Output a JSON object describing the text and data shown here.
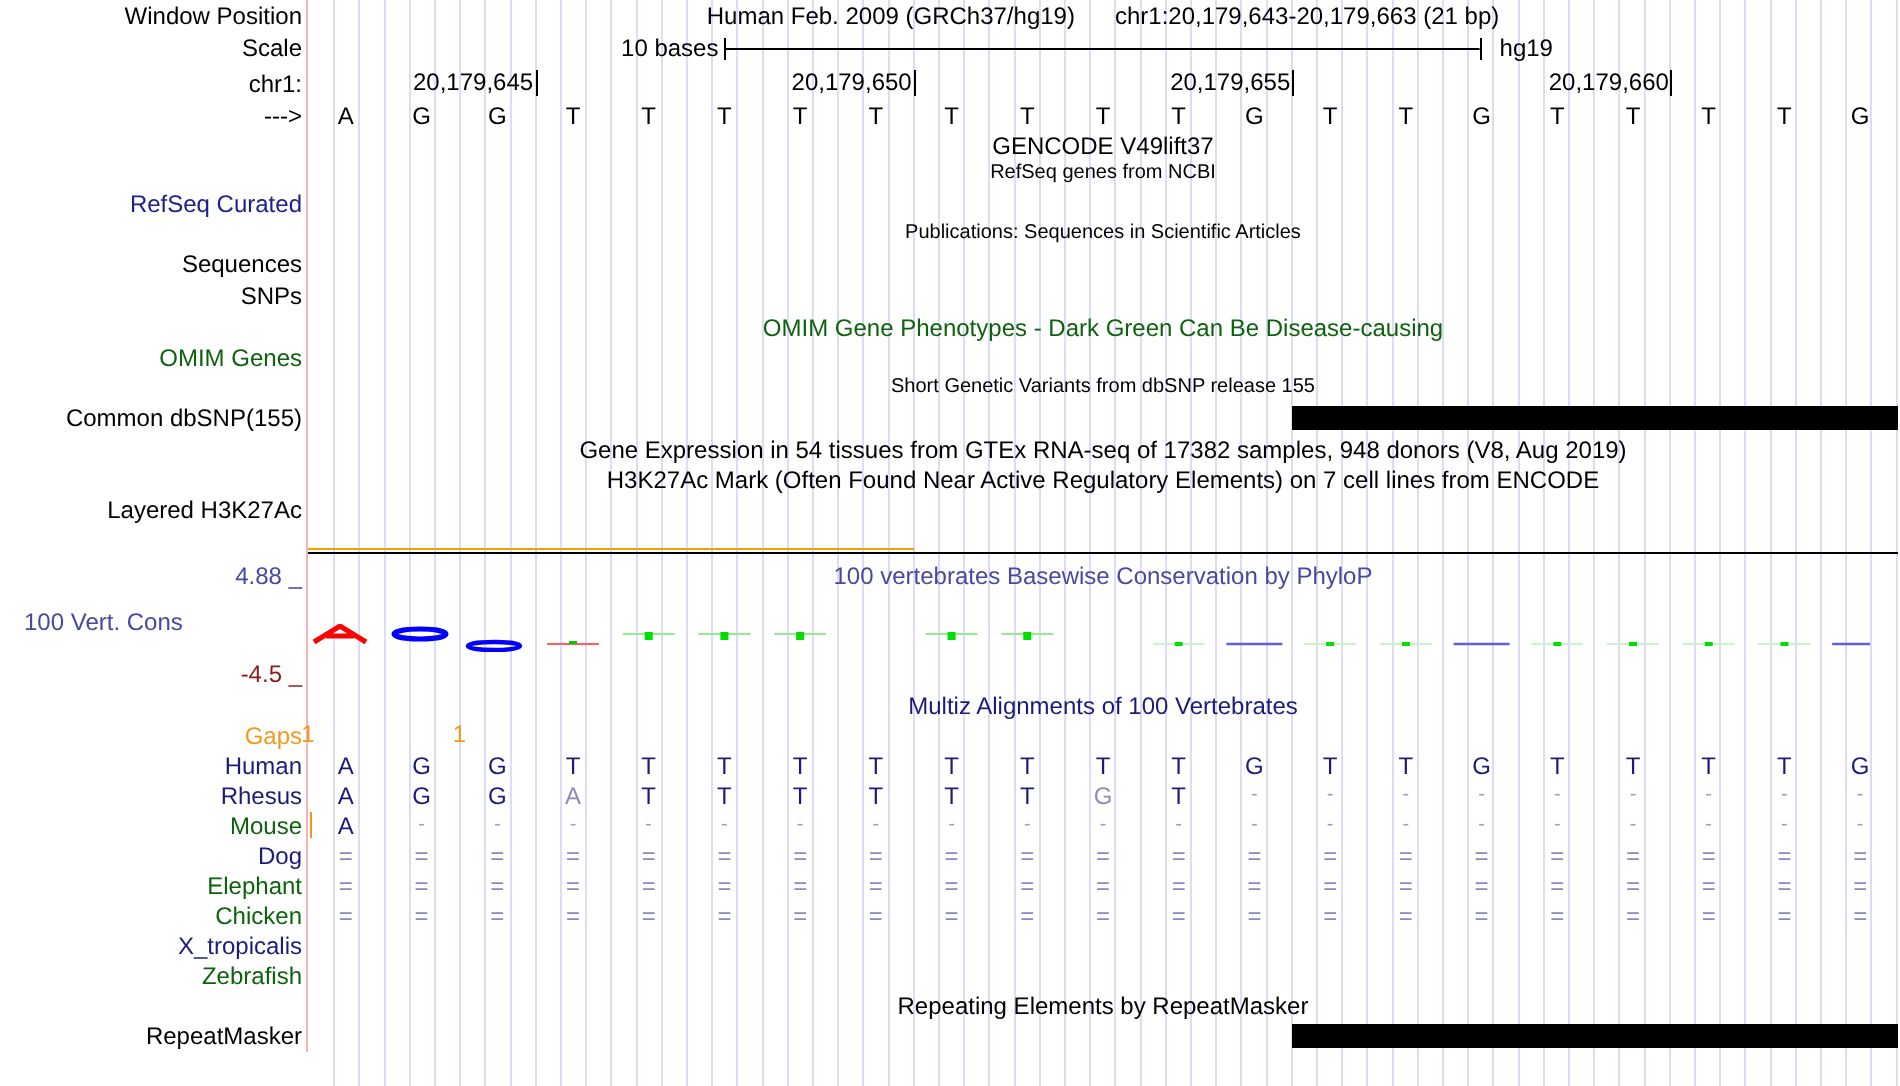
{
  "position": {
    "label": "Window Position",
    "assembly": "Human Feb. 2009 (GRCh37/hg19)",
    "range": "chr1:20,179,643-20,179,663 (21 bp)"
  },
  "scale": {
    "label": "Scale",
    "length": "10 bases",
    "assembly": "hg19"
  },
  "coordinates": {
    "label": "chr1:"
  },
  "sequence": {
    "label": "--->",
    "bases": [
      {
        "base": "A",
        "gap_before": "1"
      },
      {
        "base": "G"
      },
      {
        "base": "G",
        "tick": "20,179,645",
        "gap_before": "1"
      },
      {
        "base": "T"
      },
      {
        "base": "T"
      },
      {
        "base": "T"
      },
      {
        "base": "T"
      },
      {
        "base": "T",
        "tick": "20,179,650"
      },
      {
        "base": "T"
      },
      {
        "base": "T"
      },
      {
        "base": "T"
      },
      {
        "base": "T"
      },
      {
        "base": "G",
        "tick": "20,179,655"
      },
      {
        "base": "T"
      },
      {
        "base": "T"
      },
      {
        "base": "G"
      },
      {
        "base": "T"
      },
      {
        "base": "T",
        "tick": "20,179,660"
      },
      {
        "base": "T"
      },
      {
        "base": "T"
      },
      {
        "base": "G"
      }
    ]
  },
  "tracks": [
    {
      "kind": "title",
      "text": "GENCODE V49lift37",
      "color": "#000000"
    },
    {
      "kind": "subtitle",
      "text": "RefSeq genes from NCBI",
      "color": "#000000"
    },
    {
      "kind": "label",
      "label": "RefSeq Curated",
      "color": "#20208c"
    },
    {
      "kind": "subtitle",
      "text": "Publications: Sequences in Scientific Articles",
      "color": "#000000"
    },
    {
      "kind": "label",
      "label": "Sequences",
      "color": "#000000"
    },
    {
      "kind": "label",
      "label": "SNPs",
      "color": "#000000"
    },
    {
      "kind": "title",
      "text": "OMIM Gene Phenotypes - Dark Green Can Be Disease-causing",
      "color": "#0e620e"
    },
    {
      "kind": "label",
      "label": "OMIM Genes",
      "color": "#0e620e"
    },
    {
      "kind": "subtitle",
      "text": "Short Genetic Variants from dbSNP release 155",
      "color": "#000000"
    },
    {
      "kind": "label",
      "label": "Common dbSNP(155)",
      "color": "#000000",
      "feature": true
    },
    {
      "kind": "title",
      "text": "Gene Expression in 54 tissues from GTEx RNA-seq of 17382 samples, 948 donors (V8, Aug 2019)",
      "color": "#000000"
    },
    {
      "kind": "title",
      "text": "H3K27Ac Mark (Often Found Near Active Regulatory Elements) on 7 cell lines from ENCODE",
      "color": "#000000"
    },
    {
      "kind": "label",
      "label": "Layered H3K27Ac",
      "color": "#000000"
    },
    {
      "kind": "baseline",
      "highlight": true
    },
    {
      "kind": "conservation",
      "title": "100 vertebrates Basewise Conservation by PhyloP",
      "label": "100 Vert. Cons",
      "max": "4.88 _",
      "min": "-4.5 _"
    },
    {
      "kind": "alignment",
      "title": "Multiz Alignments of 100 Vertebrates",
      "gaps_label": "Gaps",
      "species": [
        {
          "name": "Human",
          "color": "#1c1c78",
          "insertion": false,
          "cells": [
            {
              "base": "A",
              "kind": "match"
            },
            {
              "base": "G",
              "kind": "match"
            },
            {
              "base": "G",
              "kind": "match"
            },
            {
              "base": "T",
              "kind": "match"
            },
            {
              "base": "T",
              "kind": "match"
            },
            {
              "base": "T",
              "kind": "match"
            },
            {
              "base": "T",
              "kind": "match"
            },
            {
              "base": "T",
              "kind": "match"
            },
            {
              "base": "T",
              "kind": "match"
            },
            {
              "base": "T",
              "kind": "match"
            },
            {
              "base": "T",
              "kind": "match"
            },
            {
              "base": "T",
              "kind": "match"
            },
            {
              "base": "G",
              "kind": "match"
            },
            {
              "base": "T",
              "kind": "match"
            },
            {
              "base": "T",
              "kind": "match"
            },
            {
              "base": "G",
              "kind": "match"
            },
            {
              "base": "T",
              "kind": "match"
            },
            {
              "base": "T",
              "kind": "match"
            },
            {
              "base": "T",
              "kind": "match"
            },
            {
              "base": "T",
              "kind": "match"
            },
            {
              "base": "G",
              "kind": "match"
            }
          ]
        },
        {
          "name": "Rhesus",
          "color": "#1c1c78",
          "insertion": false,
          "cells": [
            {
              "base": "A",
              "kind": "match"
            },
            {
              "base": "G",
              "kind": "match"
            },
            {
              "base": "G",
              "kind": "match"
            },
            {
              "base": "A",
              "kind": "mismatch"
            },
            {
              "base": "T",
              "kind": "match"
            },
            {
              "base": "T",
              "kind": "match"
            },
            {
              "base": "T",
              "kind": "match"
            },
            {
              "base": "T",
              "kind": "match"
            },
            {
              "base": "T",
              "kind": "match"
            },
            {
              "base": "T",
              "kind": "match"
            },
            {
              "base": "G",
              "kind": "mismatch"
            },
            {
              "base": "T",
              "kind": "match"
            },
            {
              "base": "-",
              "kind": "gap"
            },
            {
              "base": "-",
              "kind": "gap"
            },
            {
              "base": "-",
              "kind": "gap"
            },
            {
              "base": "-",
              "kind": "gap"
            },
            {
              "base": "-",
              "kind": "gap"
            },
            {
              "base": "-",
              "kind": "gap"
            },
            {
              "base": "-",
              "kind": "gap"
            },
            {
              "base": "-",
              "kind": "gap"
            },
            {
              "base": "-",
              "kind": "gap"
            }
          ]
        },
        {
          "name": "Mouse",
          "color": "#0e620e",
          "insertion": true,
          "cells": [
            {
              "base": "A",
              "kind": "match"
            },
            {
              "base": "-",
              "kind": "gap"
            },
            {
              "base": "-",
              "kind": "gap"
            },
            {
              "base": "-",
              "kind": "gap"
            },
            {
              "base": "-",
              "kind": "gap"
            },
            {
              "base": "-",
              "kind": "gap"
            },
            {
              "base": "-",
              "kind": "gap"
            },
            {
              "base": "-",
              "kind": "gap"
            },
            {
              "base": "-",
              "kind": "gap"
            },
            {
              "base": "-",
              "kind": "gap"
            },
            {
              "base": "-",
              "kind": "gap"
            },
            {
              "base": "-",
              "kind": "gap"
            },
            {
              "base": "-",
              "kind": "gap"
            },
            {
              "base": "-",
              "kind": "gap"
            },
            {
              "base": "-",
              "kind": "gap"
            },
            {
              "base": "-",
              "kind": "gap"
            },
            {
              "base": "-",
              "kind": "gap"
            },
            {
              "base": "-",
              "kind": "gap"
            },
            {
              "base": "-",
              "kind": "gap"
            },
            {
              "base": "-",
              "kind": "gap"
            },
            {
              "base": "-",
              "kind": "gap"
            }
          ]
        },
        {
          "name": "Dog",
          "color": "#1c1c78",
          "insertion": false,
          "cells": [
            {
              "base": "=",
              "kind": "unaligned"
            },
            {
              "base": "=",
              "kind": "unaligned"
            },
            {
              "base": "=",
              "kind": "unaligned"
            },
            {
              "base": "=",
              "kind": "unaligned"
            },
            {
              "base": "=",
              "kind": "unaligned"
            },
            {
              "base": "=",
              "kind": "unaligned"
            },
            {
              "base": "=",
              "kind": "unaligned"
            },
            {
              "base": "=",
              "kind": "unaligned"
            },
            {
              "base": "=",
              "kind": "unaligned"
            },
            {
              "base": "=",
              "kind": "unaligned"
            },
            {
              "base": "=",
              "kind": "unaligned"
            },
            {
              "base": "=",
              "kind": "unaligned"
            },
            {
              "base": "=",
              "kind": "unaligned"
            },
            {
              "base": "=",
              "kind": "unaligned"
            },
            {
              "base": "=",
              "kind": "unaligned"
            },
            {
              "base": "=",
              "kind": "unaligned"
            },
            {
              "base": "=",
              "kind": "unaligned"
            },
            {
              "base": "=",
              "kind": "unaligned"
            },
            {
              "base": "=",
              "kind": "unaligned"
            },
            {
              "base": "=",
              "kind": "unaligned"
            },
            {
              "base": "=",
              "kind": "unaligned"
            }
          ]
        },
        {
          "name": "Elephant",
          "color": "#0e620e",
          "insertion": false,
          "cells": [
            {
              "base": "=",
              "kind": "unaligned"
            },
            {
              "base": "=",
              "kind": "unaligned"
            },
            {
              "base": "=",
              "kind": "unaligned"
            },
            {
              "base": "=",
              "kind": "unaligned"
            },
            {
              "base": "=",
              "kind": "unaligned"
            },
            {
              "base": "=",
              "kind": "unaligned"
            },
            {
              "base": "=",
              "kind": "unaligned"
            },
            {
              "base": "=",
              "kind": "unaligned"
            },
            {
              "base": "=",
              "kind": "unaligned"
            },
            {
              "base": "=",
              "kind": "unaligned"
            },
            {
              "base": "=",
              "kind": "unaligned"
            },
            {
              "base": "=",
              "kind": "unaligned"
            },
            {
              "base": "=",
              "kind": "unaligned"
            },
            {
              "base": "=",
              "kind": "unaligned"
            },
            {
              "base": "=",
              "kind": "unaligned"
            },
            {
              "base": "=",
              "kind": "unaligned"
            },
            {
              "base": "=",
              "kind": "unaligned"
            },
            {
              "base": "=",
              "kind": "unaligned"
            },
            {
              "base": "=",
              "kind": "unaligned"
            },
            {
              "base": "=",
              "kind": "unaligned"
            },
            {
              "base": "=",
              "kind": "unaligned"
            }
          ]
        },
        {
          "name": "Chicken",
          "color": "#0e620e",
          "insertion": false,
          "cells": [
            {
              "base": "=",
              "kind": "unaligned"
            },
            {
              "base": "=",
              "kind": "unaligned"
            },
            {
              "base": "=",
              "kind": "unaligned"
            },
            {
              "base": "=",
              "kind": "unaligned"
            },
            {
              "base": "=",
              "kind": "unaligned"
            },
            {
              "base": "=",
              "kind": "unaligned"
            },
            {
              "base": "=",
              "kind": "unaligned"
            },
            {
              "base": "=",
              "kind": "unaligned"
            },
            {
              "base": "=",
              "kind": "unaligned"
            },
            {
              "base": "=",
              "kind": "unaligned"
            },
            {
              "base": "=",
              "kind": "unaligned"
            },
            {
              "base": "=",
              "kind": "unaligned"
            },
            {
              "base": "=",
              "kind": "unaligned"
            },
            {
              "base": "=",
              "kind": "unaligned"
            },
            {
              "base": "=",
              "kind": "unaligned"
            },
            {
              "base": "=",
              "kind": "unaligned"
            },
            {
              "base": "=",
              "kind": "unaligned"
            },
            {
              "base": "=",
              "kind": "unaligned"
            },
            {
              "base": "=",
              "kind": "unaligned"
            },
            {
              "base": "=",
              "kind": "unaligned"
            },
            {
              "base": "=",
              "kind": "unaligned"
            }
          ]
        },
        {
          "name": "X_tropicalis",
          "color": "#1c1c78",
          "insertion": false
        },
        {
          "name": "Zebrafish",
          "color": "#0e620e",
          "insertion": false
        }
      ]
    },
    {
      "kind": "title",
      "text": "Repeating Elements by RepeatMasker",
      "color": "#000000"
    },
    {
      "kind": "label",
      "label": "RepeatMasker",
      "color": "#000000",
      "feature": true
    }
  ]
}
